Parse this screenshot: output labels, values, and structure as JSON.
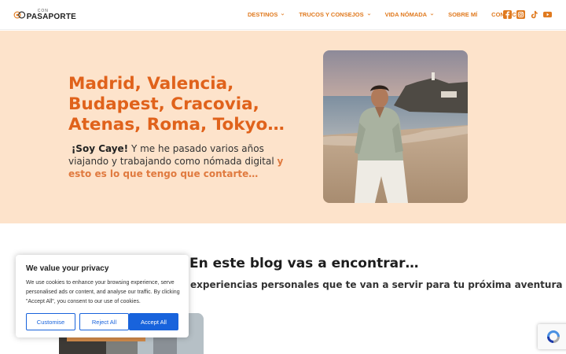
{
  "brand": {
    "small": "CON",
    "name": "PASAPORTE"
  },
  "nav": [
    {
      "label": "DESTINOS",
      "dropdown": true
    },
    {
      "label": "TRUCOS Y CONSEJOS",
      "dropdown": true
    },
    {
      "label": "VIDA NÓMADA",
      "dropdown": true
    },
    {
      "label": "SOBRE MÍ",
      "dropdown": false
    },
    {
      "label": "CONTACTO",
      "dropdown": false
    }
  ],
  "social_icons": [
    "facebook-icon",
    "instagram-icon",
    "tiktok-icon",
    "youtube-icon"
  ],
  "accent_color": "#e07a1f",
  "hero": {
    "title_lines": [
      "Madrid, Valencia,",
      "Budapest, Cracovia,",
      "Atenas, Roma, Tokyo…"
    ],
    "intro_bold": "¡Soy Caye!",
    "intro_text": " Y me he pasado varios años viajando y trabajando como nómada digital ",
    "intro_highlight": "y esto es lo que tengo que contarte…",
    "background": "#fde3cb"
  },
  "blog": {
    "title": "En este blog vas a encontrar…",
    "subtitle": "experiencias personales que te van a servir para tu próxima aventura"
  },
  "cookie": {
    "title": "We value your privacy",
    "text": "We use cookies to enhance your browsing experience, serve personalised ads or content, and analyse our traffic. By clicking \"Accept All\", you consent to our use of cookies.",
    "customise": "Customise",
    "reject": "Reject All",
    "accept": "Accept All",
    "button_color": "#1863dc"
  }
}
